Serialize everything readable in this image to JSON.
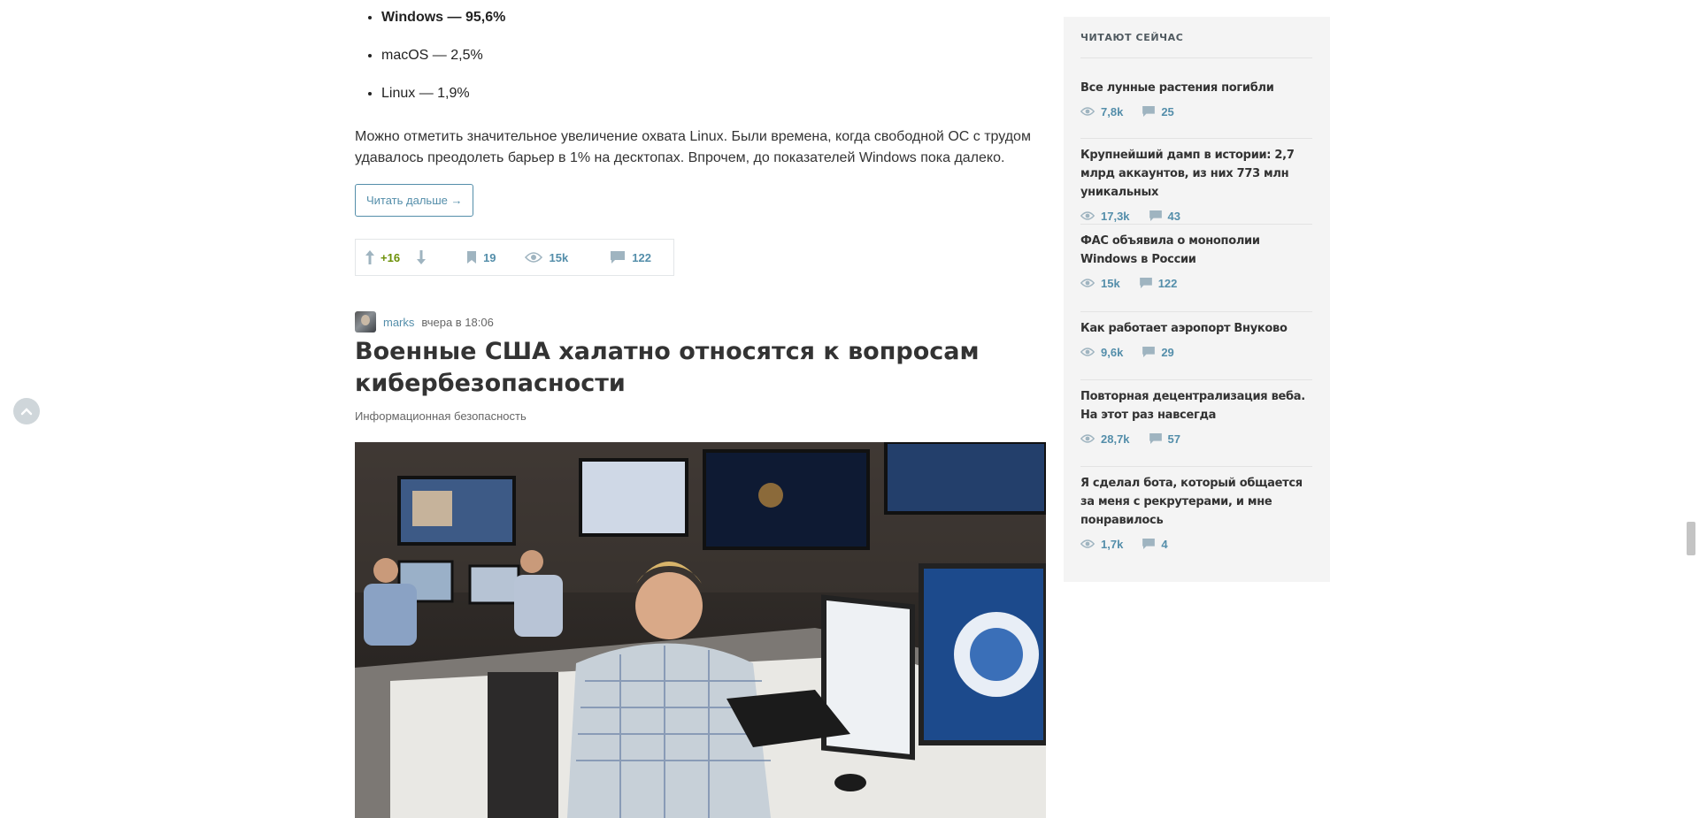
{
  "article_list": {
    "items": [
      {
        "text": "Windows — 95,6%",
        "bold": true
      },
      {
        "text": "macOS — 2,5%",
        "bold": false
      },
      {
        "text": "Linux — 1,9%",
        "bold": false
      }
    ],
    "paragraph": "Можно отметить значительное увеличение охвата Linux. Были времена, когда свободной ОС с трудом удавалось преодолеть барьер в 1% на десктопах. Впрочем, до показателей Windows пока далеко.",
    "read_more_label": "Читать дальше →",
    "stats": {
      "votes": "+16",
      "bookmarks": "19",
      "views": "15k",
      "comments": "122"
    }
  },
  "next_post": {
    "author": "marks",
    "time": "вчера в 18:06",
    "title": "Военные США халатно относятся к вопросам кибербезопасности",
    "hub": "Информационная безопасность"
  },
  "sidebar": {
    "title": "ЧИТАЮТ СЕЙЧАС",
    "items": [
      {
        "title": "Все лунные растения погибли",
        "views": "7,8k",
        "comments": "25"
      },
      {
        "title": "Крупнейший дамп в истории: 2,7 млрд аккаунтов, из них 773 млн уникальных",
        "views": "17,3k",
        "comments": "43"
      },
      {
        "title": "ФАС объявила о монополии Windows в России",
        "views": "15k",
        "comments": "122"
      },
      {
        "title": "Как работает аэропорт Внуково",
        "views": "9,6k",
        "comments": "29"
      },
      {
        "title": "Повторная децентрализация веба. На этот раз навсегда",
        "views": "28,7k",
        "comments": "57"
      },
      {
        "title": "Я сделал бота, который общается за меня с рекрутерами, и мне понравилось",
        "views": "1,7k",
        "comments": "4"
      }
    ]
  },
  "colors": {
    "link": "#548eaa",
    "votes_positive": "#6c9007",
    "icon": "#9fb4c0",
    "sidebar_bg": "#f4f4f4"
  },
  "icons": [
    "chevron-up-icon",
    "arrow-up-icon",
    "arrow-down-icon",
    "bookmark-icon",
    "eye-icon",
    "comment-icon"
  ]
}
